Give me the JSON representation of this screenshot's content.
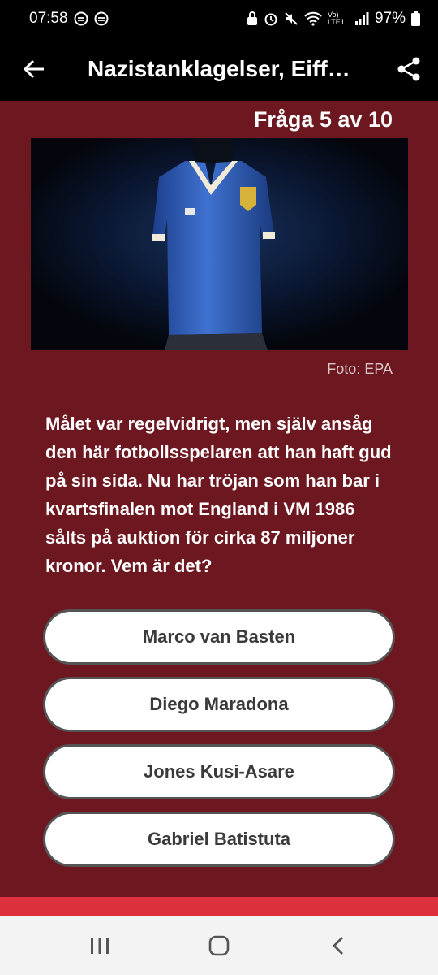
{
  "status_bar": {
    "time": "07:58",
    "battery": "97%",
    "network": "Vo) LTE1"
  },
  "app_bar": {
    "title": "Nazistanklagelser, Eiffel…"
  },
  "quiz": {
    "counter": "Fråga 5 av 10",
    "photo_credit": "Foto: EPA",
    "question": "Målet var regelvidrigt, men själv ansåg den här fotbollsspelaren att han haft gud på sin sida. Nu har tröjan som han bar i kvartsfinalen mot England i VM 1986 sålts på auktion för cirka 87 miljoner kronor. Vem är det?",
    "answers": [
      {
        "label": "Marco van Basten"
      },
      {
        "label": "Diego Maradona"
      },
      {
        "label": "Jones Kusi-Asare"
      },
      {
        "label": "Gabriel Batistuta"
      }
    ]
  },
  "colors": {
    "background": "#6d1820",
    "accent": "#dd2f3c",
    "topbar": "#000000"
  },
  "icons": [
    "back-arrow-icon",
    "share-icon",
    "recents-icon",
    "home-icon",
    "back-chevron-icon"
  ]
}
